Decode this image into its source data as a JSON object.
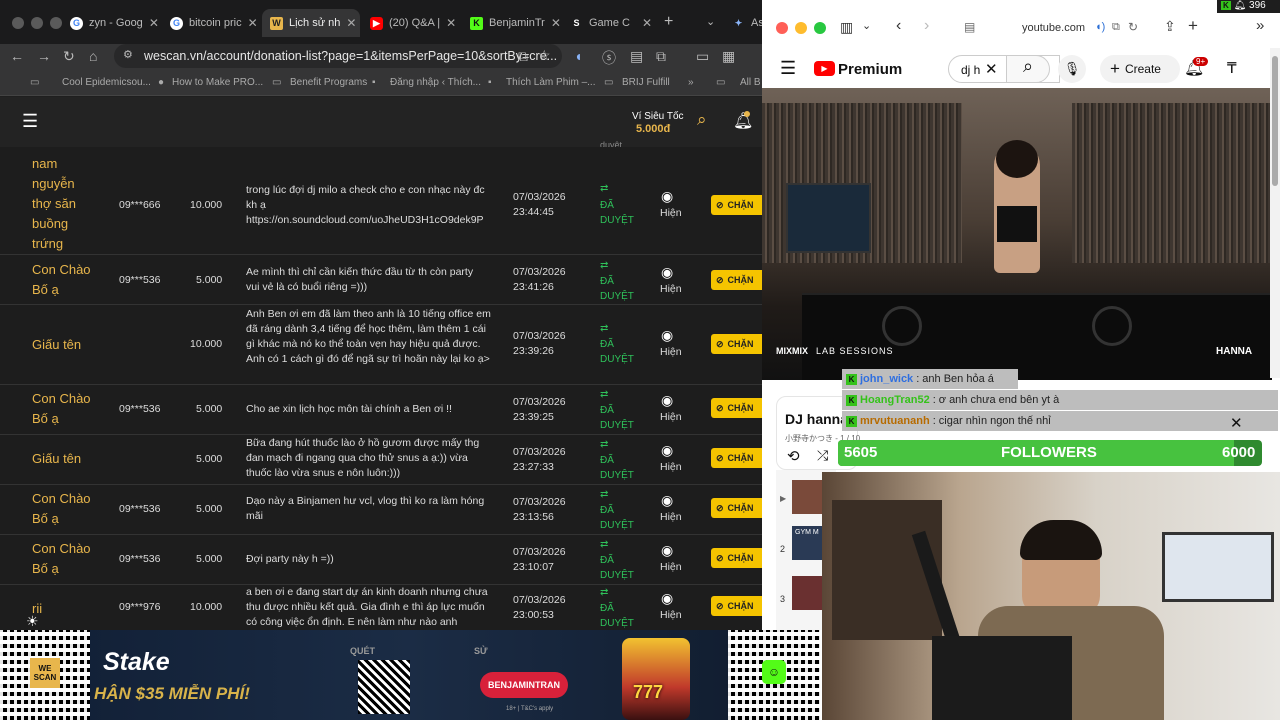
{
  "tabs": [
    {
      "label": "zyn - Goog",
      "icon": "google-icon",
      "color": "#4285f4"
    },
    {
      "label": "bitcoin pric",
      "icon": "google-icon",
      "color": "#4285f4"
    },
    {
      "label": "Lịch sử nh",
      "icon": "wescan-icon",
      "color": "#e8b64c"
    },
    {
      "label": "(20) Q&A |",
      "icon": "youtube-icon",
      "color": "#ff0000"
    },
    {
      "label": "BenjaminTr",
      "icon": "kick-icon",
      "color": "#53fc18"
    },
    {
      "label": "Game C",
      "icon": "stake-icon",
      "color": "#ffffff"
    },
    {
      "label": "Ask",
      "icon": "sparkle-icon",
      "color": "#8ab4f8"
    }
  ],
  "address": "wescan.vn/account/donation-list?page=1&itemsPerPage=10&sortBy=cre...",
  "bookmarks": [
    "Cool Epidemicsou...",
    "How to Make PRO...",
    "Benefit Programs",
    "Đăng nhập ‹ Thích...",
    "Thích Làm Phim –...",
    "BRIJ Fulfill",
    "All B"
  ],
  "header": {
    "wallet_label": "Ví Siêu Tốc",
    "wallet_amount": "5.000đ",
    "col_status_peek": "duyệt"
  },
  "rows": [
    {
      "name": "nam\nnguyễn\nthợ săn\nbuồng\ntrứng",
      "phone": "09***666",
      "amount": "10.000",
      "message": "trong lúc đợi dj milo a check cho e con nhạc này đc kh ạ https://on.soundcloud.com/uoJheUD3H1cO9dek9P",
      "date": "07/03/2026\n23:44:45",
      "status": "ĐÃ\nDUYỆT",
      "visibility": "Hiện",
      "action": "CHẶN"
    },
    {
      "name": "Con Chào\nBố ạ",
      "phone": "09***536",
      "amount": "5.000",
      "message": "Ae mình thì chỉ cần kiến thức đầu từ th còn party vui vẻ là có buổi riêng =)))",
      "date": "07/03/2026\n23:41:26",
      "status": "ĐÃ\nDUYỆT",
      "visibility": "Hiện",
      "action": "CHẶN"
    },
    {
      "name": "Giấu tên",
      "phone": "",
      "amount": "10.000",
      "message": "Anh Ben ơi em đã làm theo anh là 10 tiếng office em đã ráng dành 3,4 tiếng để học thêm, làm thêm 1 cái gì khác mà nó ko thể toàn vẹn hay hiệu quả được. Anh có 1 cách gì đó để ngã sự trì hoãn này lại ko ạ>",
      "date": "07/03/2026\n23:39:26",
      "status": "ĐÃ\nDUYỆT",
      "visibility": "Hiện",
      "action": "CHẶN"
    },
    {
      "name": "Con Chào\nBố ạ",
      "phone": "09***536",
      "amount": "5.000",
      "message": "Cho ae xin lịch học môn tài chính a Ben ơi !!",
      "date": "07/03/2026\n23:39:25",
      "status": "ĐÃ\nDUYỆT",
      "visibility": "Hiện",
      "action": "CHẶN"
    },
    {
      "name": "Giấu tên",
      "phone": "",
      "amount": "5.000",
      "message": "Bữa đang hút thuốc lào ở hồ gươm được mấy thg đan mạch đi ngang qua cho thử snus a ạ:)) vừa thuốc lào vừa snus e nôn luôn:)))",
      "date": "07/03/2026\n23:27:33",
      "status": "ĐÃ\nDUYỆT",
      "visibility": "Hiện",
      "action": "CHẶN"
    },
    {
      "name": "Con Chào\nBố ạ",
      "phone": "09***536",
      "amount": "5.000",
      "message": "Dạo này a Binjamen hư vcl, vlog thì ko ra làm hóng mãi",
      "date": "07/03/2026\n23:13:56",
      "status": "ĐÃ\nDUYỆT",
      "visibility": "Hiện",
      "action": "CHẶN"
    },
    {
      "name": "Con Chào\nBố ạ",
      "phone": "09***536",
      "amount": "5.000",
      "message": "Đợi party này h =))",
      "date": "07/03/2026\n23:10:07",
      "status": "ĐÃ\nDUYỆT",
      "visibility": "Hiện",
      "action": "CHẶN"
    },
    {
      "name": "rii",
      "phone": "09***976",
      "amount": "10.000",
      "message": "a ben ơi e đang start dự án kinh doanh nhưng chưa thu được nhiều kết quả. Gia đình e thì áp lực muốn có công việc ổn định. E nên làm như nào anh",
      "date": "07/03/2026\n23:00:53",
      "status": "ĐÃ\nDUYỆT",
      "visibility": "Hiện",
      "action": "CHẶN"
    }
  ],
  "banner": {
    "brand": "Stake",
    "promo": "HẬN $35 MIỄN PHÍ!",
    "scan_label": "QUÉT",
    "use_label": "SỬ",
    "code": "BENJAMINTRAN",
    "fine_print": "18+ | T&C's apply",
    "slot": "777",
    "wescan_label": "WE SCAN"
  },
  "right_browser": {
    "domain": "youtube.com",
    "notif_count": "396"
  },
  "youtube": {
    "logo": "Premium",
    "search_value": "dj h",
    "create_label": "Create",
    "notif_badge": "9+"
  },
  "video": {
    "logo_left": "MIXMIX",
    "logo_mid": "LAB SESSIONS",
    "logo_right": "HANNA"
  },
  "chat": [
    {
      "user": "john_wick",
      "text": ": anh Ben hỏa á",
      "color": "#2f6fe0"
    },
    {
      "user": "HoangTran52",
      "text": ": ơ anh chưa end bên yt à",
      "color": "#35c21b"
    },
    {
      "user": "mrvutuananh",
      "text": ": cigar nhìn ngon thế nhỉ",
      "color": "#b76b00"
    }
  ],
  "playlist": {
    "title": "DJ hanna",
    "subtitle": "小野寺かつき - 1 / 10",
    "items": [
      "2",
      "3"
    ],
    "thumb2_label": "GYM M"
  },
  "followers": {
    "current": "5605",
    "label": "FOLLOWERS",
    "goal": "6000",
    "progress": 0.934
  }
}
